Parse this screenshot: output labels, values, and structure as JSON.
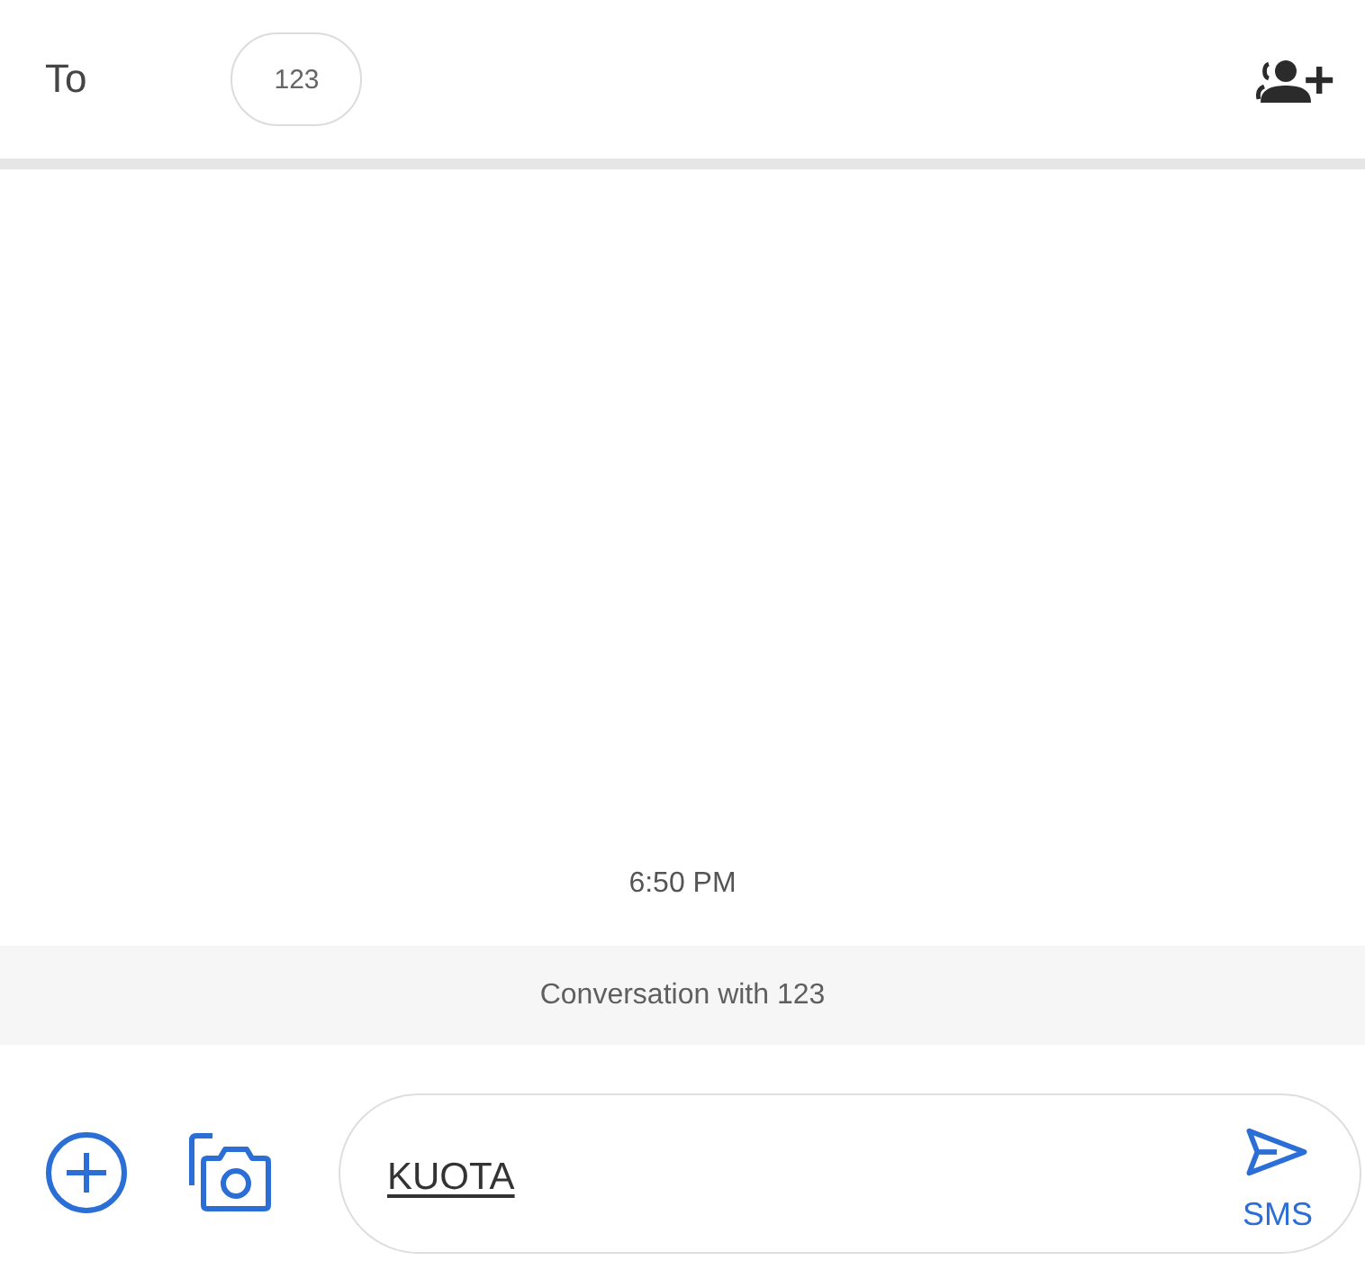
{
  "header": {
    "to_label": "To",
    "recipients": [
      {
        "label": "123"
      }
    ]
  },
  "conversation": {
    "timestamp": "6:50 PM",
    "banner": "Conversation with 123"
  },
  "composer": {
    "message": {
      "value": "KUOTA",
      "composing": true
    },
    "send_button": {
      "label": "SMS"
    }
  }
}
